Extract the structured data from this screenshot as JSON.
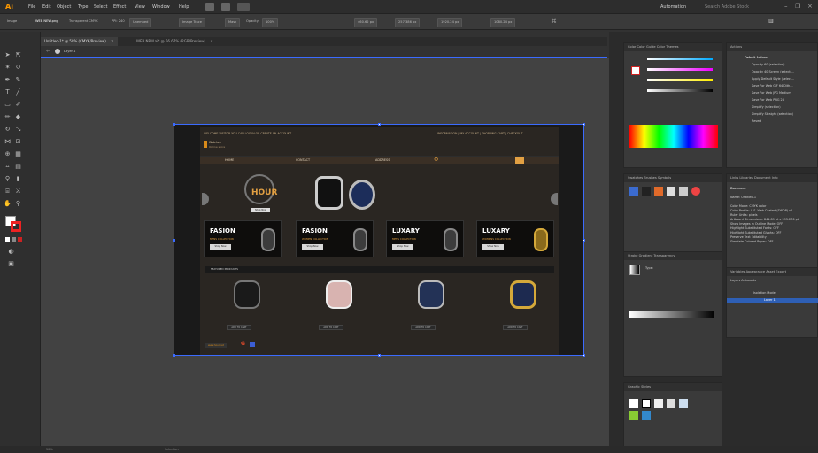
{
  "app": {
    "logo": "Ai"
  },
  "menus": [
    "File",
    "Edit",
    "Object",
    "Type",
    "Select",
    "Effect",
    "View",
    "Window",
    "Help"
  ],
  "header_right": {
    "workspace": "Automation",
    "search_placeholder": "Search Adobe Stock"
  },
  "control_bar": {
    "label": "Image",
    "file": "WEB NEW.png",
    "mode": "Transparent CMYK",
    "ppi": "PPI: 240",
    "embed": "Unembed",
    "trace": "Image Trace",
    "mask": "Mask",
    "opacity_label": "Opacity:",
    "opacity": "100%",
    "x": "460.62 px",
    "y": "257.386 px",
    "w": "1920.24 px",
    "h": "1080.24 px"
  },
  "doc_tabs": [
    {
      "label": "Untitled-1* @ 50% (CMYK/Preview)",
      "close": "×"
    },
    {
      "label": "WEB NEW.ai* @ 66.67% (RGB/Preview)",
      "close": "×"
    }
  ],
  "layer_label": "Layer 1",
  "website": {
    "welcome": "WELCOME VISITOR YOU CAN LOG IN OR CREATE AN ACCOUNT",
    "top_links": "INFORMATION | MY ACCOUNT | SHOPPING CART | CHECKOUT",
    "brand_line1": "Watches",
    "brand_line2": "Online store",
    "nav": [
      "HOME",
      "CONTACT",
      "ADDRESS"
    ],
    "hero_text": "HOUR",
    "hero_btn": "Shop Now",
    "cards": [
      {
        "title": "FASION",
        "sub": "MENS COLLECTION",
        "btn": "Shop Now"
      },
      {
        "title": "FASION",
        "sub": "WOMEN COLLECTION",
        "btn": "Shop Now"
      },
      {
        "title": "LUXARY",
        "sub": "MENS COLLECTION",
        "btn": "Shop Now"
      },
      {
        "title": "LUXARY",
        "sub": "WOMENS COLLECTION",
        "btn": "Show Now"
      }
    ],
    "featured": "FEATURED PRODUCTS",
    "add_btns": [
      "ADD TO CART",
      "ADD TO CART",
      "ADD TO CART",
      "ADD TO CART"
    ],
    "footer_brand": "www.hour.net"
  },
  "panels": {
    "color_tabs": "Color  Color Guide  Color Themes",
    "actions_title": "Actions",
    "actions": [
      "Default Actions",
      "Opacity 60 (selection)",
      "Opacity 40 Screen (selecti...",
      "Apply Default Style (select...",
      "Save For Web GIF 64 Dith...",
      "Save For Web JPG Medium",
      "Save For Web PNG 24",
      "Simplify (selection)",
      "Simplify Straight (selection)",
      "Revert"
    ],
    "swatch_tabs": "Swatches  Brushes  Symbols",
    "docinfo_tabs": "Links  Libraries  Document Info",
    "docinfo_heading": "Document",
    "docinfo_name": "Name: Untitled-1",
    "docinfo": [
      "Color Mode: CMYK color",
      "Color Profile: U.S. Web Coated (SWOP) v2",
      "Ruler Units: pixels",
      "Artboard Dimensions: 841.89 pt x 595.276 pt",
      "Show Images in Outline Mode: OFF",
      "Highlight Substituted Fonts: OFF",
      "Highlight Substituted Glyphs: OFF",
      "Preserve Text Editability",
      "Simulate Colored Paper: OFF"
    ],
    "stroke_tabs": "Stroke  Gradient  Transparency",
    "gradient_type": "Type:",
    "graphic_styles": "Graphic Styles",
    "layers_tabs": "Variables  Appearance  Asset Export",
    "layers_sub": "Layers  Artboards",
    "layer_rows": [
      "Isolation Mode",
      "Layer 1"
    ]
  },
  "status": {
    "zoom": "50%",
    "tool": "Selection"
  }
}
